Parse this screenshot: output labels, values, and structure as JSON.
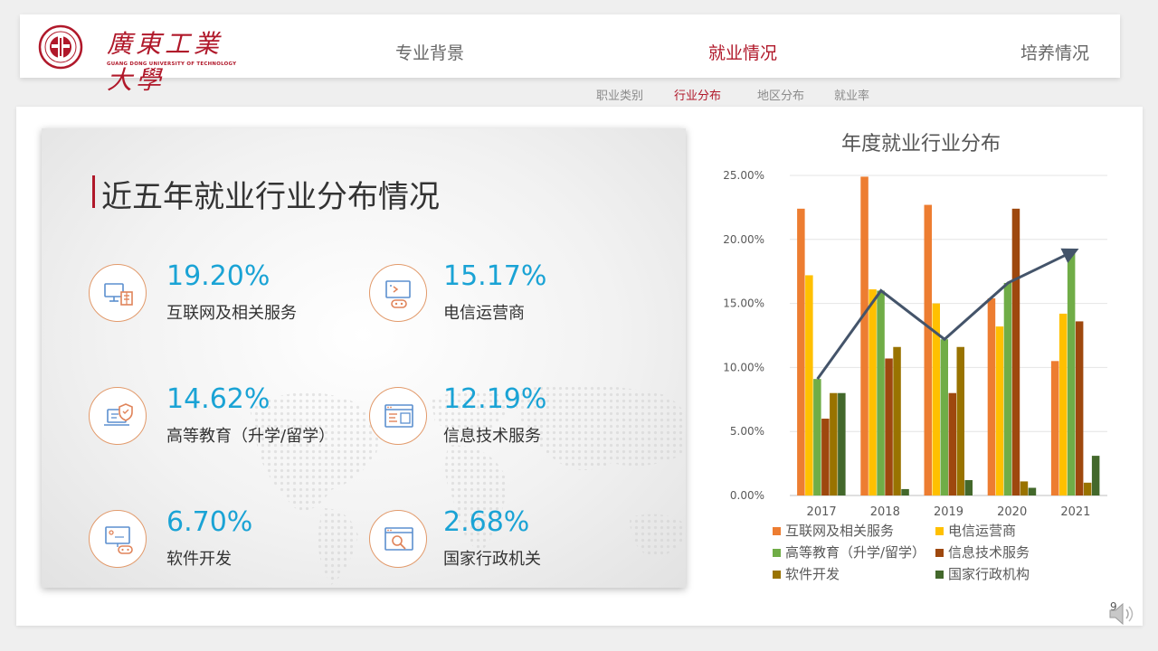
{
  "logo": {
    "name": "廣東工業大學",
    "name_en": "GUANG DONG UNIVERSITY OF TECHNOLOGY"
  },
  "nav": {
    "items": [
      {
        "label": "专业背景",
        "active": false
      },
      {
        "label": "就业情况",
        "active": true
      },
      {
        "label": "培养情况",
        "active": false
      }
    ]
  },
  "subnav": {
    "items": [
      {
        "label": "职业类别",
        "active": false
      },
      {
        "label": "行业分布",
        "active": true
      },
      {
        "label": "地区分布",
        "active": false
      },
      {
        "label": "就业率",
        "active": false
      }
    ]
  },
  "card": {
    "title": "近五年就业行业分布情况",
    "stats": [
      {
        "value": "19.20%",
        "label": "互联网及相关服务",
        "icon": "computer-building-icon"
      },
      {
        "value": "15.17%",
        "label": "电信运营商",
        "icon": "monitor-gamepad-icon"
      },
      {
        "value": "14.62%",
        "label": "高等教育（升学/留学）",
        "icon": "laptop-shield-icon"
      },
      {
        "value": "12.19%",
        "label": "信息技术服务",
        "icon": "browser-code-icon"
      },
      {
        "value": "6.70%",
        "label": "软件开发",
        "icon": "monitor-controller-icon"
      },
      {
        "value": "2.68%",
        "label": "国家行政机关",
        "icon": "browser-search-icon"
      }
    ]
  },
  "chart_data": {
    "type": "bar",
    "title": "年度就业行业分布",
    "categories": [
      "2017",
      "2018",
      "2019",
      "2020",
      "2021"
    ],
    "ylim": [
      0,
      25
    ],
    "yticks": [
      "0.00%",
      "5.00%",
      "10.00%",
      "15.00%",
      "20.00%",
      "25.00%"
    ],
    "grid": true,
    "legend_position": "bottom",
    "series": [
      {
        "name": "互联网及相关服务",
        "color": "#ED7D31",
        "values": [
          22.4,
          24.9,
          22.7,
          15.4,
          10.5
        ]
      },
      {
        "name": "电信运营商",
        "color": "#FFC000",
        "values": [
          17.2,
          16.1,
          15.0,
          13.2,
          14.2
        ]
      },
      {
        "name": "高等教育（升学/留学）",
        "color": "#70AD47",
        "values": [
          9.1,
          16.0,
          12.2,
          16.6,
          19.0
        ]
      },
      {
        "name": "信息技术服务",
        "color": "#9E480E",
        "values": [
          6.0,
          10.7,
          8.0,
          22.4,
          13.6
        ]
      },
      {
        "name": "软件开发",
        "color": "#997300",
        "values": [
          8.0,
          11.6,
          11.6,
          1.1,
          1.0
        ]
      },
      {
        "name": "国家行政机构",
        "color": "#43682B",
        "values": [
          8.0,
          0.5,
          1.2,
          0.6,
          3.1
        ]
      }
    ],
    "trend_series": "高等教育（升学/留学）",
    "trend_color": "#44546A"
  },
  "page_number": "9"
}
